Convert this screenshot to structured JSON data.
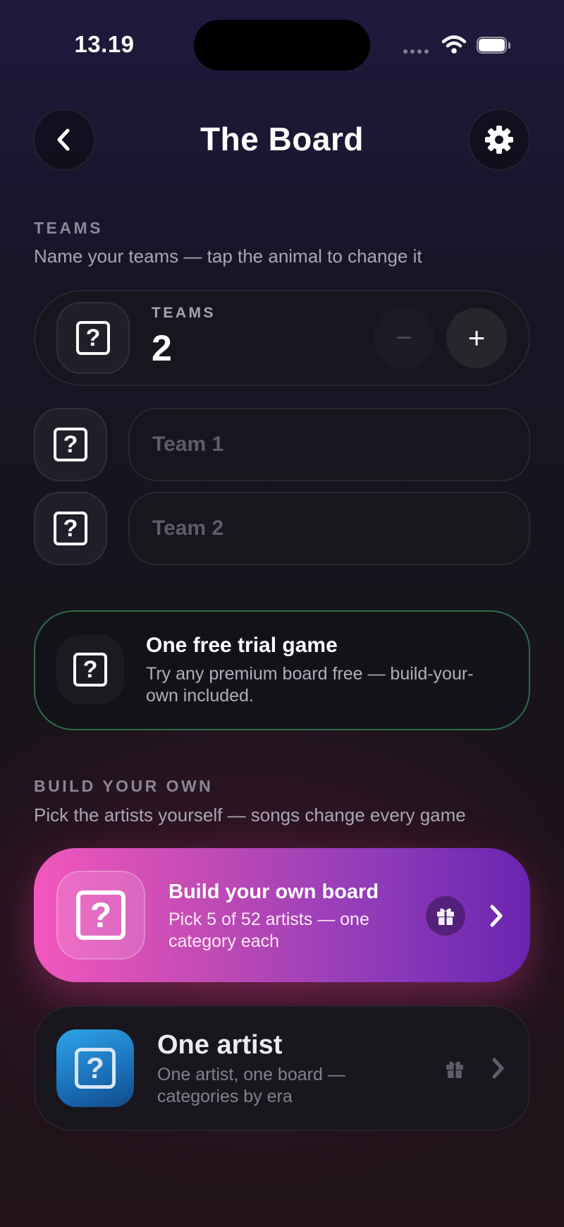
{
  "status_bar": {
    "time": "13.19"
  },
  "header": {
    "title": "The Board",
    "back_icon": "chevron-left-icon",
    "settings_icon": "gear-icon"
  },
  "teams_section": {
    "label": "TEAMS",
    "subtitle": "Name your teams — tap the animal to change it",
    "counter_label": "TEAMS",
    "count": "2",
    "minus_symbol": "−",
    "plus_symbol": "+",
    "team_inputs": [
      {
        "placeholder": "Team 1"
      },
      {
        "placeholder": "Team 2"
      }
    ]
  },
  "trial_banner": {
    "title": "One free trial game",
    "description": "Try any premium board free — build-your-own included.",
    "border_color": "#2f6a48"
  },
  "build_section": {
    "label": "BUILD YOUR OWN",
    "subtitle": "Pick the artists yourself — songs change every game",
    "cards": [
      {
        "title": "Build your own board",
        "description": "Pick 5 of 52 artists — one category each",
        "badge_icon": "gift-icon",
        "gradient": [
          "#f257bd",
          "#6a24b0"
        ]
      },
      {
        "title": "One artist",
        "description": "One artist, one board — categories by era",
        "badge_icon": "gift-icon",
        "tile_color": "#1a6fb8"
      }
    ]
  },
  "placeholder_icon": "question-mark-icon"
}
